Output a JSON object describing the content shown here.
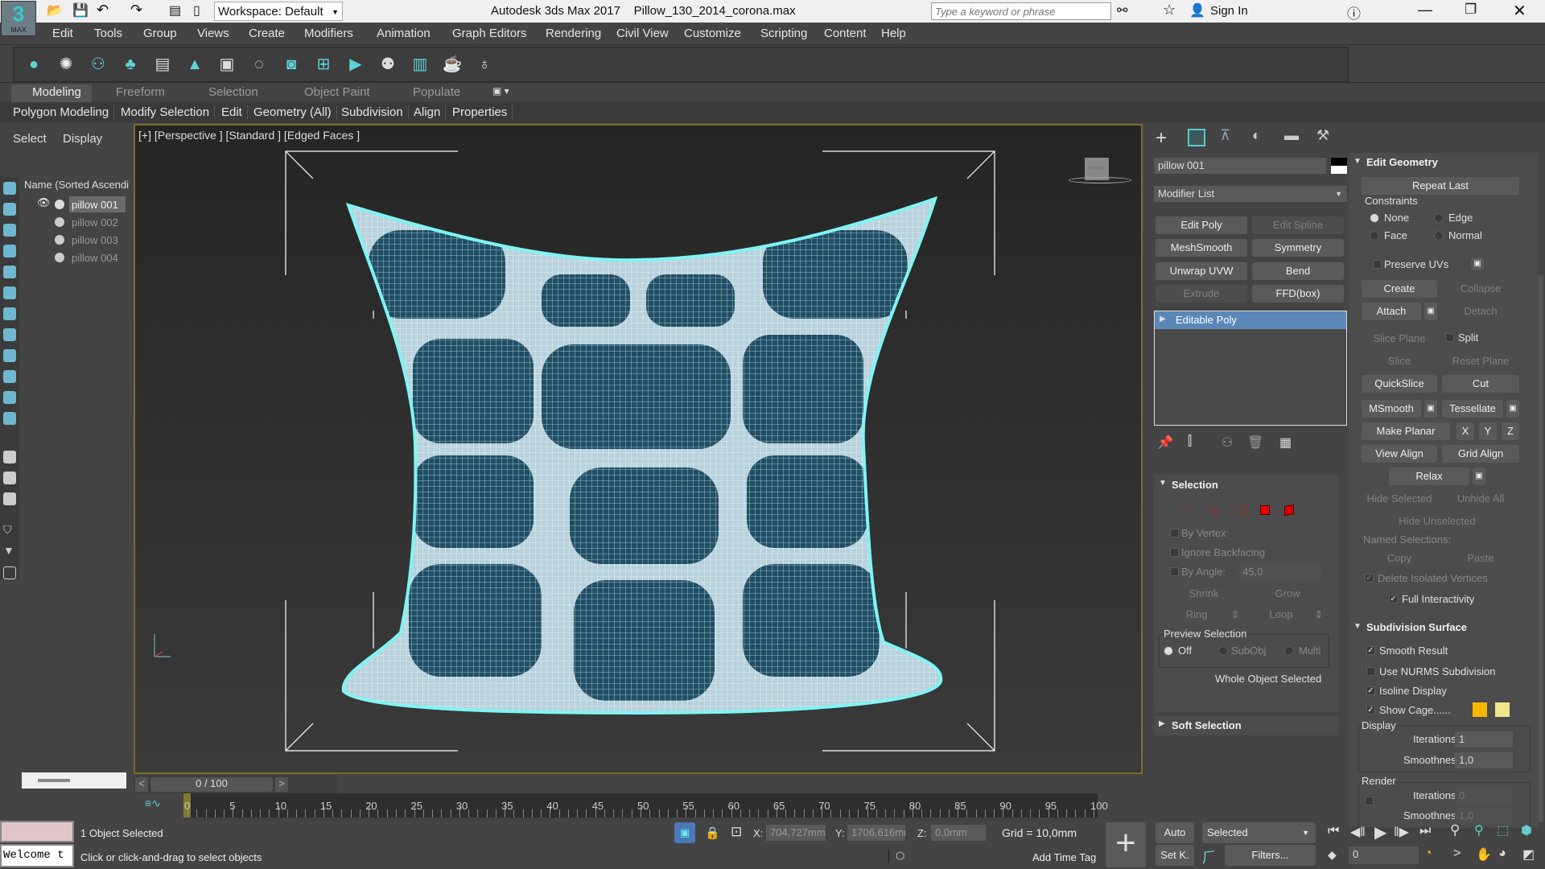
{
  "title_bar": {
    "app_badge": "3",
    "app_badge_sub": "MAX",
    "workspace": "Workspace: Default",
    "title": "Autodesk 3ds Max 2017",
    "file": "Pillow_130_2014_corona.max",
    "search_placeholder": "Type a keyword or phrase",
    "sign_in": "Sign In"
  },
  "menu": [
    "Edit",
    "Tools",
    "Group",
    "Views",
    "Create",
    "Modifiers",
    "Animation",
    "Graph Editors",
    "Rendering",
    "Civil View",
    "Customize",
    "Scripting",
    "Content",
    "Help"
  ],
  "ribbon": {
    "tabs": [
      "Modeling",
      "Freeform",
      "Selection",
      "Object Paint",
      "Populate"
    ],
    "items": [
      "Polygon Modeling",
      "Modify Selection",
      "Edit",
      "Geometry (All)",
      "Subdivision",
      "Align",
      "Properties"
    ]
  },
  "scene_explorer": {
    "tabs": [
      "Select",
      "Display"
    ],
    "header": "Name (Sorted Ascendi",
    "objects": [
      "pillow 001",
      "pillow 002",
      "pillow 003",
      "pillow 004"
    ]
  },
  "viewport": {
    "label": "[+] [Perspective ] [Standard ] [Edged Faces ]",
    "viewcube": "FRONT"
  },
  "command_panel": {
    "object_name": "pillow 001",
    "modifier_list": "Modifier List",
    "modifier_buttons": [
      "Edit Poly",
      "Edit Spline",
      "MeshSmooth",
      "Symmetry",
      "Unwrap UVW",
      "Bend",
      "Extrude",
      "FFD(box)"
    ],
    "stack": [
      "Editable Poly"
    ],
    "selection": {
      "title": "Selection",
      "by_vertex": "By Vertex",
      "ignore_backfacing": "Ignore Backfacing",
      "by_angle": "By Angle:",
      "angle": "45,0",
      "shrink": "Shrink",
      "grow": "Grow",
      "ring": "Ring",
      "loop": "Loop",
      "preview": "Preview Selection",
      "off": "Off",
      "subobj": "SubObj",
      "multi": "Multi",
      "status": "Whole Object Selected"
    },
    "soft_selection": "Soft Selection",
    "edit_geometry": {
      "title": "Edit Geometry",
      "repeat_last": "Repeat Last",
      "constraints": "Constraints",
      "none": "None",
      "edge": "Edge",
      "face": "Face",
      "normal": "Normal",
      "preserve_uvs": "Preserve UVs",
      "create": "Create",
      "collapse": "Collapse",
      "attach": "Attach",
      "detach": "Detach",
      "slice_plane": "Slice Plane",
      "split": "Split",
      "slice": "Slice",
      "reset_plane": "Reset Plane",
      "quickslice": "QuickSlice",
      "cut": "Cut",
      "msmooth": "MSmooth",
      "tessellate": "Tessellate",
      "make_planar": "Make Planar",
      "x": "X",
      "y": "Y",
      "z": "Z",
      "view_align": "View Align",
      "grid_align": "Grid Align",
      "relax": "Relax",
      "hide_selected": "Hide Selected",
      "unhide_all": "Unhide All",
      "hide_unselected": "Hide Unselected",
      "named_selections": "Named Selections:",
      "copy": "Copy",
      "paste": "Paste",
      "delete_isolated": "Delete Isolated Vertices",
      "full_interactivity": "Full Interactivity"
    },
    "subdivision": {
      "title": "Subdivision Surface",
      "smooth_result": "Smooth Result",
      "use_nurms": "Use NURMS Subdivision",
      "isoline": "Isoline Display",
      "show_cage": "Show Cage......",
      "cage_colors": [
        "#f5b800",
        "#f0e68c"
      ],
      "display": "Display",
      "iterations_label": "Iterations:",
      "iterations": "1",
      "smoothness_label": "Smoothness:",
      "smoothness": "1,0",
      "render": "Render",
      "render_iterations": "0",
      "render_smoothness": "1,0"
    }
  },
  "timeline": {
    "frame": "0 / 100",
    "ticks": [
      "0",
      "5",
      "10",
      "15",
      "20",
      "25",
      "30",
      "35",
      "40",
      "45",
      "50",
      "55",
      "60",
      "65",
      "70",
      "75",
      "80",
      "85",
      "90",
      "95",
      "100"
    ]
  },
  "status": {
    "welcome": "Welcome t",
    "selected": "1 Object Selected",
    "prompt": "Click or click-and-drag to select objects",
    "x_label": "X:",
    "x": "704,727mm",
    "y_label": "Y:",
    "y": "1706,616mm",
    "z_label": "Z:",
    "z": "0,0mm",
    "grid": "Grid = 10,0mm",
    "add_time_tag": "Add Time Tag",
    "auto": "Auto",
    "set_key": "Set K.",
    "key_filter": "Selected",
    "filters": "Filters...",
    "current_frame": "0"
  }
}
